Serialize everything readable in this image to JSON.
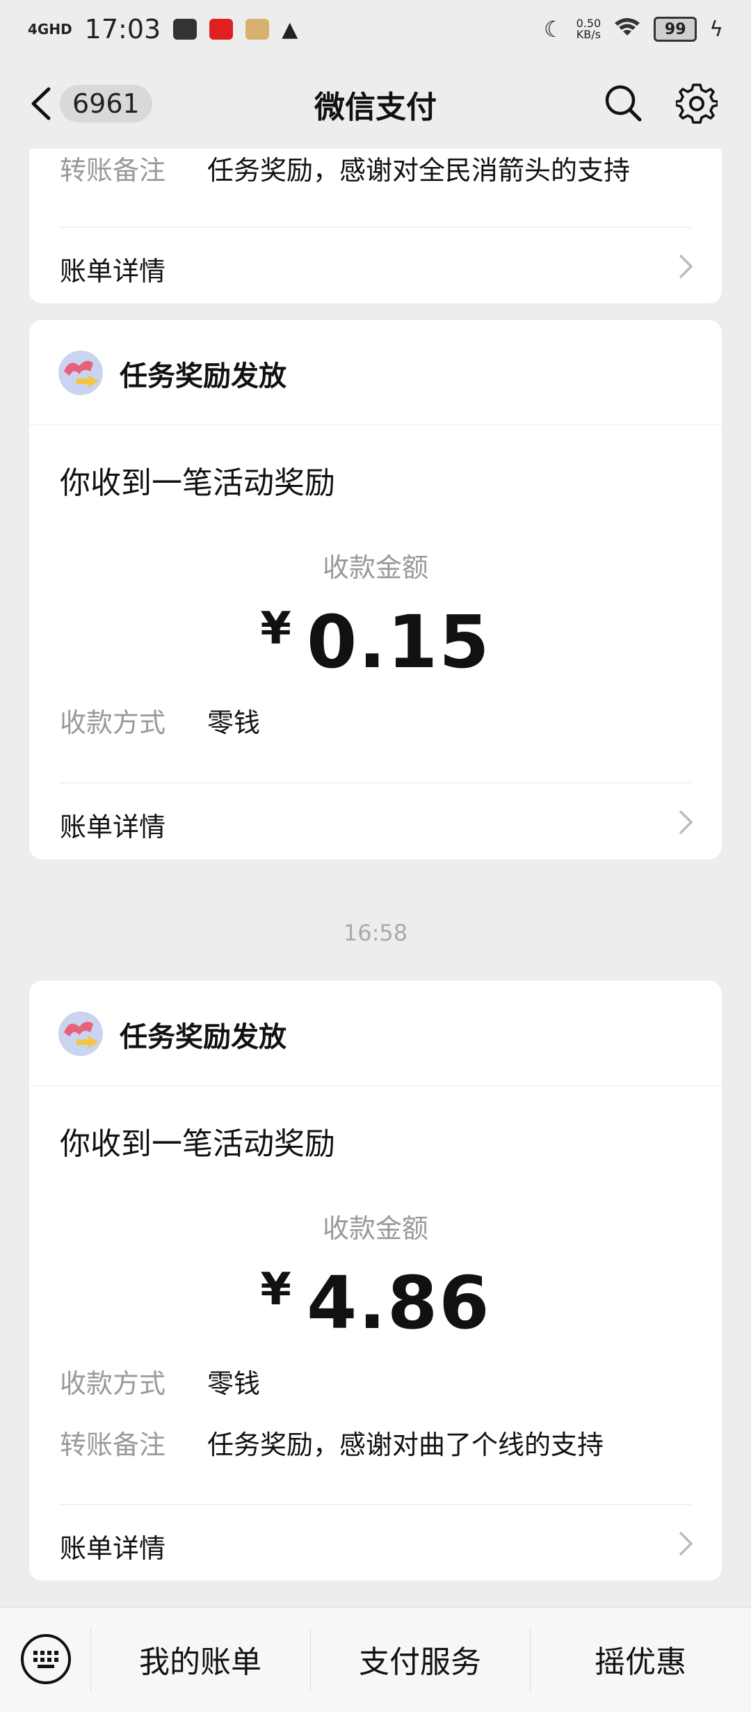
{
  "status": {
    "network": "4GHD",
    "time": "17:03",
    "speed_value": "0.50",
    "speed_unit": "KB/s",
    "battery": "99"
  },
  "nav": {
    "badge": "6961",
    "title": "微信支付"
  },
  "card_top": {
    "note_label": "转账备注",
    "note_value": "任务奖励，感谢对全民消箭头的支持",
    "bill_link": "账单详情"
  },
  "card1": {
    "brand": "任务奖励发放",
    "headline": "你收到一笔活动奖励",
    "amount_label": "收款金额",
    "currency": "¥",
    "amount": "0.15",
    "method_label": "收款方式",
    "method_value": "零钱",
    "bill_link": "账单详情"
  },
  "timestamp": "16:58",
  "card2": {
    "brand": "任务奖励发放",
    "headline": "你收到一笔活动奖励",
    "amount_label": "收款金额",
    "currency": "¥",
    "amount": "4.86",
    "method_label": "收款方式",
    "method_value": "零钱",
    "note_label": "转账备注",
    "note_value": "任务奖励，感谢对曲了个线的支持",
    "bill_link": "账单详情"
  },
  "bottom": {
    "items": [
      "我的账单",
      "支付服务",
      "摇优惠"
    ]
  }
}
